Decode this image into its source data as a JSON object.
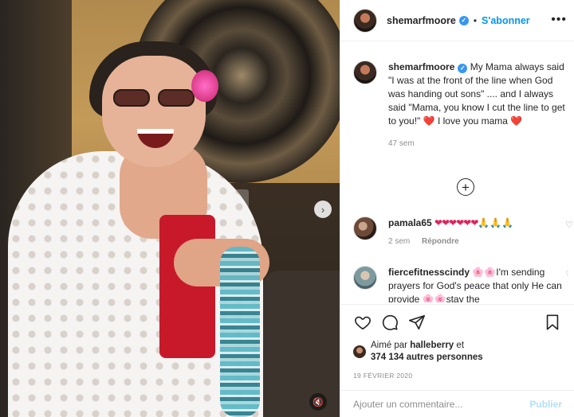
{
  "post": {
    "username": "shemarfmoore",
    "follow_label": "S'abonner",
    "separator": "•",
    "more_icon": "more-horizontal-icon"
  },
  "caption": {
    "username": "shemarfmoore",
    "text": "My Mama always said \"I was at the front of the line when God was handing out sons\" .... and I always said \"Mama, you know I cut the line to get to you!\"",
    "heart": "❤️",
    "text_end": "I love you mama",
    "age": "47 sem"
  },
  "comments": [
    {
      "username": "pamala65",
      "hearts": "❤❤❤❤❤❤",
      "praise": "🙏🙏🙏",
      "age": "2 sem",
      "reply_label": "Répondre"
    },
    {
      "username": "fiercefitnesscindy",
      "emoji": "🌸🌸",
      "text": "I'm sending prayers for God's peace that only He can provide",
      "text_cut": "stay the"
    }
  ],
  "actions": {
    "liked_by_prefix": "Aimé par",
    "liked_by_user": "halleberry",
    "liked_by_join": "et",
    "others_count": "374 134 autres personnes",
    "date": "19 FÉVRIER 2020"
  },
  "comment_box": {
    "placeholder": "Ajouter un commentaire...",
    "publish_label": "Publier"
  },
  "colors": {
    "link_blue": "#0095f6",
    "verified_blue": "#3897f0",
    "heart_red": "#e0245e",
    "muted_gray": "#8e8e8e"
  }
}
